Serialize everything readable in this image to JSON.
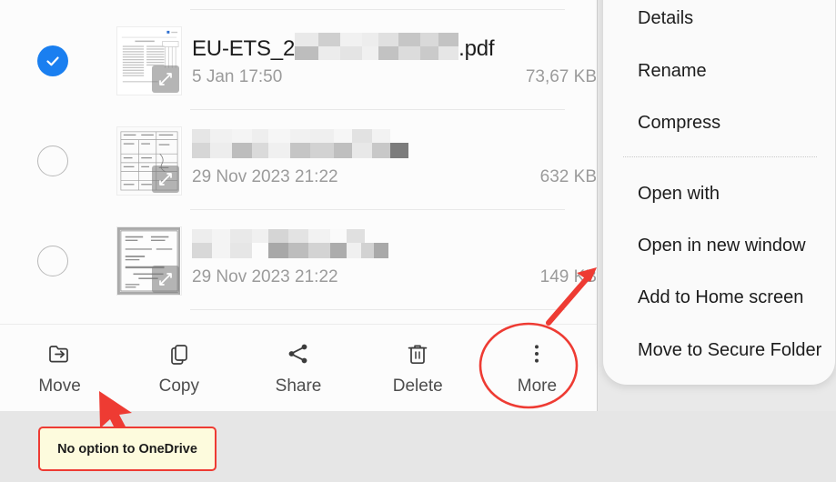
{
  "app": {
    "kind": "android-file-manager-screenshot",
    "accent_blue": "#1a7ff0",
    "annotation_red": "#ee3b33",
    "callout_fill": "#fdfbdd"
  },
  "file_list": {
    "rows": [
      {
        "selected": true,
        "checkbox_state": "checked",
        "name_prefix": "EU-ETS_2",
        "name_redacted": true,
        "name_suffix": ".pdf",
        "date": "5 Jan 17:50",
        "size": "73,67 KB",
        "thumbnail": "document-thumbnail-table",
        "expand_icon": "expand-icon"
      },
      {
        "selected": false,
        "checkbox_state": "unchecked",
        "name_prefix": "",
        "name_redacted": true,
        "name_suffix": "",
        "date": "29 Nov 2023 21:22",
        "size": "632 KB",
        "thumbnail": "document-thumbnail-form",
        "expand_icon": "expand-icon"
      },
      {
        "selected": false,
        "checkbox_state": "unchecked",
        "name_prefix": "",
        "name_redacted": true,
        "name_suffix": "",
        "date": "29 Nov 2023 21:22",
        "size": "149 KB",
        "thumbnail": "document-thumbnail-scan",
        "expand_icon": "expand-icon"
      }
    ]
  },
  "toolbar": {
    "items": [
      {
        "label": "Move",
        "icon": "move-to-folder-icon"
      },
      {
        "label": "Copy",
        "icon": "copy-icon"
      },
      {
        "label": "Share",
        "icon": "share-icon"
      },
      {
        "label": "Delete",
        "icon": "trash-icon"
      },
      {
        "label": "More",
        "icon": "more-vertical-icon"
      }
    ]
  },
  "context_menu": {
    "items": [
      {
        "label": "Details"
      },
      {
        "label": "Rename"
      },
      {
        "label": "Compress"
      },
      {
        "label": "Open with"
      },
      {
        "label": "Open in new window"
      },
      {
        "label": "Add to Home screen"
      },
      {
        "label": "Move to Secure Folder"
      }
    ]
  },
  "annotations": {
    "callout_label": "No option to OneDrive",
    "circle_target": "More",
    "arrow_to_more_menu": true,
    "arrow_to_move": true
  }
}
